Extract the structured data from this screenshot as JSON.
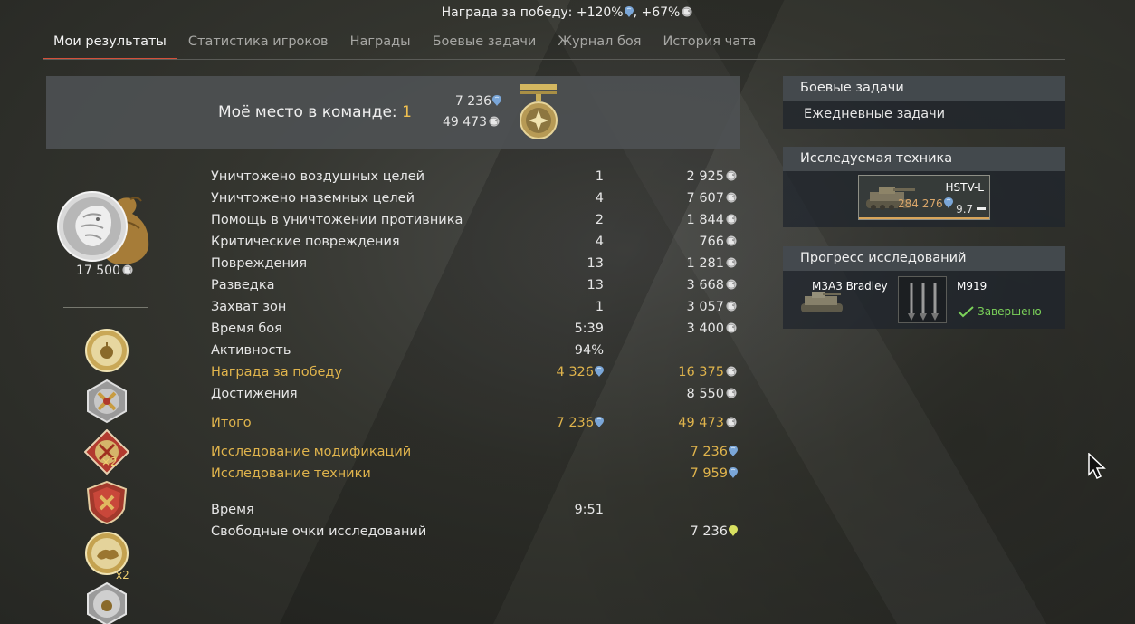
{
  "header": {
    "reward_text": "Награда за победу: +120%",
    "reward_text_2": ", +67%"
  },
  "tabs": [
    {
      "label": "Мои результаты"
    },
    {
      "label": "Статистика игроков"
    },
    {
      "label": "Награды"
    },
    {
      "label": "Боевые задачи"
    },
    {
      "label": "Журнал боя"
    },
    {
      "label": "История чата"
    }
  ],
  "place": {
    "label": "Моё место в команде: ",
    "value": "1",
    "rp": "7 236",
    "sl": "49 473"
  },
  "eagles": {
    "value": "17 500"
  },
  "badges": {
    "multiplier_1": "×2",
    "multiplier_2": "x2"
  },
  "stats": [
    {
      "label": "Уничтожено воздушных целей",
      "count": "1",
      "reward": "2 925"
    },
    {
      "label": "Уничтожено наземных целей",
      "count": "4",
      "reward": "7 607"
    },
    {
      "label": "Помощь в уничтожении противника",
      "count": "2",
      "reward": "1 844"
    },
    {
      "label": "Критические повреждения",
      "count": "4",
      "reward": "766"
    },
    {
      "label": "Повреждения",
      "count": "13",
      "reward": "1 281"
    },
    {
      "label": "Разведка",
      "count": "13",
      "reward": "3 668"
    },
    {
      "label": "Захват зон",
      "count": "1",
      "reward": "3 057"
    },
    {
      "label": "Время боя",
      "count": "5:39",
      "reward": "3 400"
    },
    {
      "label": "Активность",
      "count": "94%",
      "reward": ""
    },
    {
      "label": "Награда за победу",
      "count": "4 326",
      "reward": "16 375"
    },
    {
      "label": "Достижения",
      "count": "",
      "reward": "8 550"
    }
  ],
  "totals": {
    "label": "Итого",
    "rp": "7 236",
    "sl": "49 473"
  },
  "research": [
    {
      "label": "Исследование модификаций",
      "value": "7 236"
    },
    {
      "label": "Исследование техники",
      "value": "7 959"
    }
  ],
  "time": {
    "label": "Время",
    "value": "9:51"
  },
  "free_rp": {
    "label": "Свободные очки исследований",
    "value": "7 236"
  },
  "right": {
    "tasks": {
      "title": "Боевые задачи",
      "daily": "Ежедневные задачи"
    },
    "researched": {
      "title": "Исследуемая техника",
      "vehicle_name": "HSTV-L",
      "vehicle_rp": "284 276",
      "vehicle_br": "9.7"
    },
    "progress": {
      "title": "Прогресс исследований",
      "item1": "M3A3 Bradley",
      "item2": "M919",
      "status": "Завершено"
    }
  },
  "colors": {
    "accent": "#d5503a",
    "gold": "#e0b44c",
    "rp_blue": "#7aa6d8",
    "done_green": "#7bd25a"
  }
}
